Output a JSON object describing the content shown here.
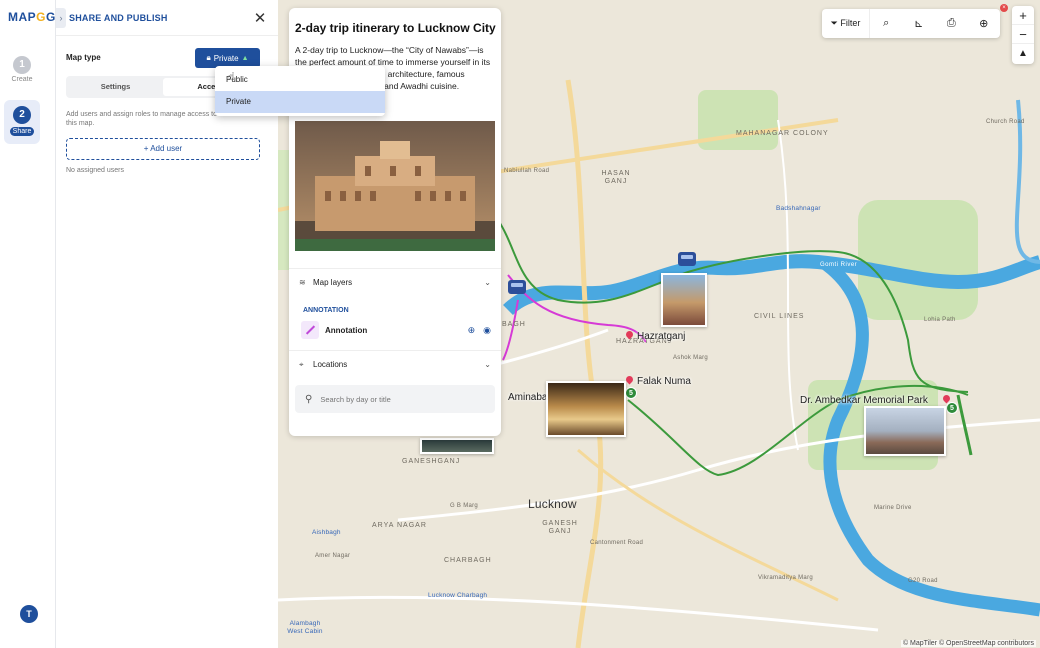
{
  "app": {
    "logo_text": "MAP",
    "logo_highlight": "G",
    "logo_tail": "G"
  },
  "rail": {
    "steps": [
      {
        "num": "1",
        "label": "Create"
      },
      {
        "num": "2",
        "label": "Share"
      }
    ],
    "avatar_initial": "T"
  },
  "panel": {
    "title": "SHARE AND PUBLISH",
    "map_type_label": "Map type",
    "privacy_value": "Private",
    "tabs": [
      {
        "label": "Settings"
      },
      {
        "label": "Access"
      }
    ],
    "access_description": "Add users and assign roles to manage access to this map.",
    "add_user_label": "+ Add user",
    "no_users_text": "No assigned users"
  },
  "dropdown": {
    "options": [
      {
        "label": "Public",
        "selected": false
      },
      {
        "label": "Private",
        "selected": true
      }
    ]
  },
  "toolbar": {
    "filter_label": "Filter",
    "icons": [
      "filter-icon",
      "search-icon",
      "ruler-icon",
      "print-icon",
      "locate-icon"
    ],
    "zoom_in": "+",
    "zoom_out": "−",
    "compass": "▲"
  },
  "card": {
    "title": "2-day trip itinerary to Lucknow City",
    "description": "A 2-day trip to Lucknow—the “City of Nawabs”—is the perfect amount of time to immerse yourself in its tehzeeb (culture), grand architecture, famous Chikankari embroidery, and Awadhi cuisine.",
    "map_layers_label": "Map layers",
    "annotation_header": "ANNOTATION",
    "annotation_label": "Annotation",
    "locations_label": "Locations",
    "search_placeholder": "Search by day or title"
  },
  "map": {
    "areas": [
      "MAHANAGAR COLONY",
      "HASAN GANJ",
      "CIVIL LINES",
      "HAZRATGANJ",
      "BAGH",
      "GANESHGANJ",
      "GANESH GANJ",
      "ARYA NAGAR",
      "CHARBAGH"
    ],
    "small_labels": [
      "Church Road",
      "Lohia Path",
      "Amer Nagar",
      "Nabiullah Road",
      "Ashok Marg",
      "Cantonment Road",
      "G B Marg",
      "Vikramaditya Marg",
      "G20 Road",
      "Marine Drive"
    ],
    "stations": [
      "Badshahnagar",
      "Aishbagh",
      "Lucknow Charbagh",
      "Alambagh West Cabin"
    ],
    "river_label": "Gomti River",
    "city_label": "Lucknow",
    "places": [
      "Hazratganj",
      "Falak Numa",
      "Dr. Ambedkar Memorial Park",
      "Aminabad"
    ],
    "marker_number": "5",
    "attribution": "© MapTiler © OpenStreetMap contributors"
  },
  "colors": {
    "brand": "#1f4f9c",
    "river": "#4aa8e0",
    "route_green": "#2e8b3a",
    "route_magenta": "#d63ad6",
    "park": "#cde3b4"
  }
}
